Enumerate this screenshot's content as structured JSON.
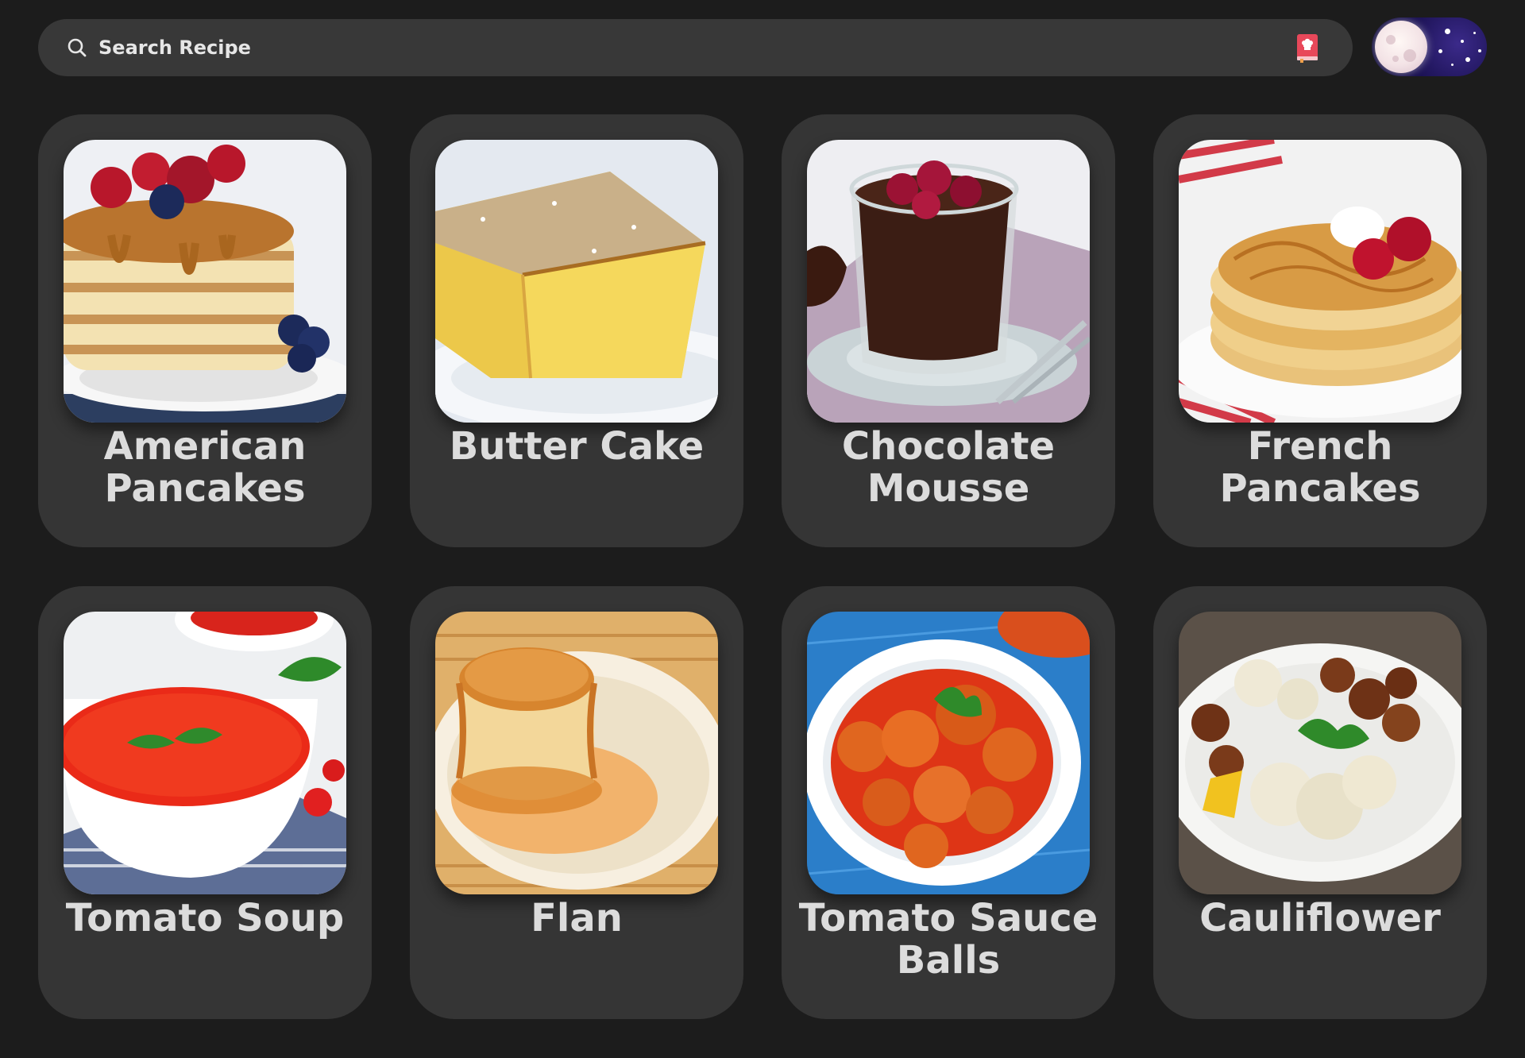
{
  "search": {
    "placeholder": "Search Recipe",
    "icon": "search-icon",
    "recipe_book_icon": "recipe-book-icon"
  },
  "theme_toggle": {
    "mode": "dark",
    "icon": "moon-icon"
  },
  "colors": {
    "background": "#1c1c1c",
    "card": "#353535",
    "search_bar": "#383838",
    "text": "#dcdcdc",
    "accent": "#e8485a"
  },
  "recipes": [
    {
      "title": "American Pancakes"
    },
    {
      "title": "Butter Cake"
    },
    {
      "title": "Chocolate Mousse"
    },
    {
      "title": "French Pancakes"
    },
    {
      "title": "Tomato Soup"
    },
    {
      "title": "Flan"
    },
    {
      "title": "Tomato Sauce Balls"
    },
    {
      "title": "Cauliflower"
    }
  ]
}
